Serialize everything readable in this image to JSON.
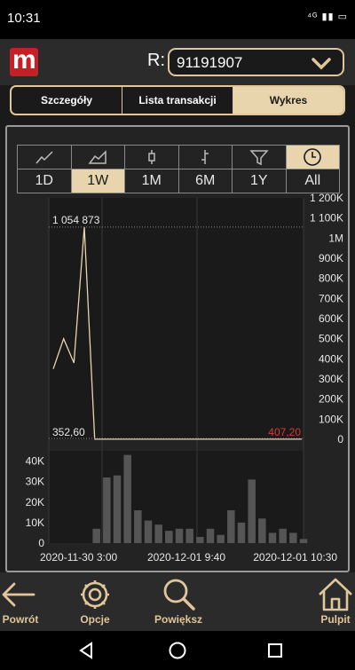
{
  "status_bar": {
    "time": "10:31",
    "icons": "⁴ᴳ ▮▮ ▭"
  },
  "header": {
    "logo_letter": "m",
    "account_label": "R:",
    "account_value": "91191907"
  },
  "tabs": [
    {
      "label": "Szczegóły"
    },
    {
      "label": "Lista transakcji"
    },
    {
      "label": "Wykres",
      "active": true
    }
  ],
  "chart_types": [
    "line-chart-icon",
    "area-chart-icon",
    "candlestick-icon",
    "ohlc-icon",
    "filter-icon",
    "clock-icon"
  ],
  "chart_type_active": "clock-icon",
  "periods": [
    "1D",
    "1W",
    "1M",
    "6M",
    "1Y",
    "All"
  ],
  "period_active": "1W",
  "colors": {
    "accent": "#e0c69a",
    "price_line": "#e8d5ad",
    "last_value": "#d23a3a",
    "volume_bar": "#555555"
  },
  "chart_data": [
    {
      "type": "line",
      "title": "",
      "ylim": [
        0,
        1200000
      ],
      "yticks": [
        "1 200K",
        "1 100K",
        "1M",
        "900K",
        "800K",
        "700K",
        "600K",
        "500K",
        "400K",
        "300K",
        "200K",
        "100K",
        "0"
      ],
      "max_label": "1 054 873",
      "min_label": "352,60",
      "last_label": "407,20",
      "x": [
        0,
        1,
        2,
        3,
        4,
        5,
        6,
        7,
        8,
        9,
        10,
        11,
        12,
        13,
        14,
        15,
        16,
        17,
        18,
        19,
        20,
        21,
        22,
        23,
        24
      ],
      "values": [
        350000,
        500000,
        380000,
        1054873,
        450,
        420,
        400,
        410,
        390,
        405,
        380,
        410,
        400,
        415,
        395,
        420,
        400,
        410,
        352.6,
        380,
        400,
        395,
        410,
        405,
        407.2
      ],
      "grid": true
    },
    {
      "type": "bar",
      "ylim": [
        0,
        45000
      ],
      "yticks": [
        "40K",
        "30K",
        "20K",
        "10K",
        "0"
      ],
      "values": [
        0,
        0,
        0,
        0,
        7000,
        32000,
        33000,
        43000,
        16000,
        11000,
        9000,
        6000,
        7000,
        7000,
        3000,
        7000,
        4000,
        16000,
        10000,
        31000,
        12000,
        5000,
        7000,
        5000,
        2000
      ],
      "xticks": [
        "2020-11-30 3:00",
        "2020-12-01 9:40",
        "2020-12-01 10:30"
      ]
    }
  ],
  "footer": [
    {
      "label": "Powrót"
    },
    {
      "label": "Opcje"
    },
    {
      "label": "Powiększ"
    },
    {
      "label": "Pulpit"
    }
  ]
}
